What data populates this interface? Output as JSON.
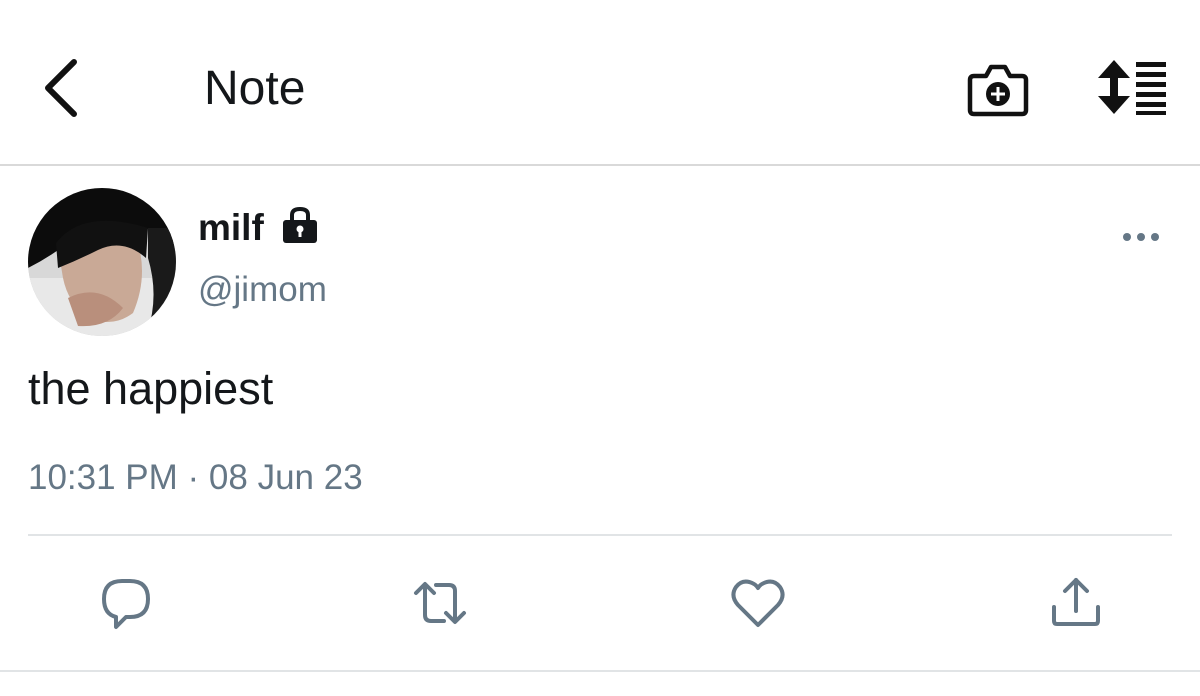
{
  "header": {
    "back_icon": "chevron-left-icon",
    "title": "Note",
    "camera_icon": "camera-add-icon",
    "sort_icon": "sort-list-icon"
  },
  "tweet": {
    "author": {
      "display_name": "milf",
      "protected_icon": "lock-icon",
      "handle": "@jimom",
      "avatar": "profile-photo"
    },
    "more_icon": "more-horizontal-icon",
    "text": "the happiest",
    "timestamp": "10:31 PM · 08 Jun 23"
  },
  "actions": [
    {
      "name": "reply",
      "icon": "reply-bubble-icon"
    },
    {
      "name": "retweet",
      "icon": "retweet-icon"
    },
    {
      "name": "like",
      "icon": "heart-icon"
    },
    {
      "name": "share",
      "icon": "share-upload-icon"
    }
  ],
  "colors": {
    "primary_text": "#14171a",
    "secondary_text": "#657786",
    "divider": "#e1e4e6"
  }
}
